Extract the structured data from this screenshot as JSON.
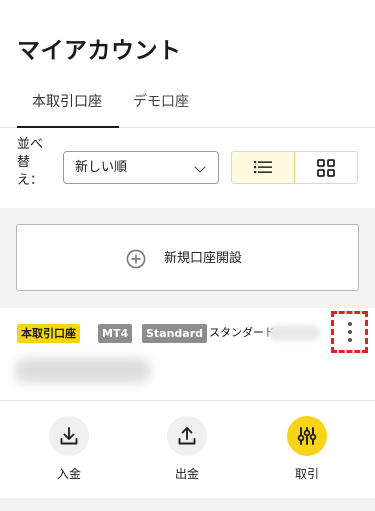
{
  "page": {
    "title": "マイアカウント"
  },
  "tabs": [
    {
      "label": "本取引口座",
      "active": true
    },
    {
      "label": "デモ口座",
      "active": false
    }
  ],
  "sort": {
    "label": "並べ替え：",
    "selected": "新しい順"
  },
  "view_toggle": {
    "active": "list",
    "icons": [
      "list-icon",
      "grid-icon"
    ]
  },
  "new_account": {
    "label": "新規口座開設",
    "icon": "plus-circle-icon"
  },
  "account_card": {
    "badges": [
      "本取引口座",
      "MT4",
      "Standard"
    ],
    "account_type": "スタンダード-",
    "more_icon": "more-vertical-icon",
    "highlight_color": "#e3221d"
  },
  "actions": [
    {
      "label": "入金",
      "icon": "download-icon"
    },
    {
      "label": "出金",
      "icon": "upload-icon"
    },
    {
      "label": "取引",
      "icon": "sliders-icon"
    }
  ],
  "colors": {
    "accent": "#f7d417",
    "background": "#f3f3f3"
  }
}
